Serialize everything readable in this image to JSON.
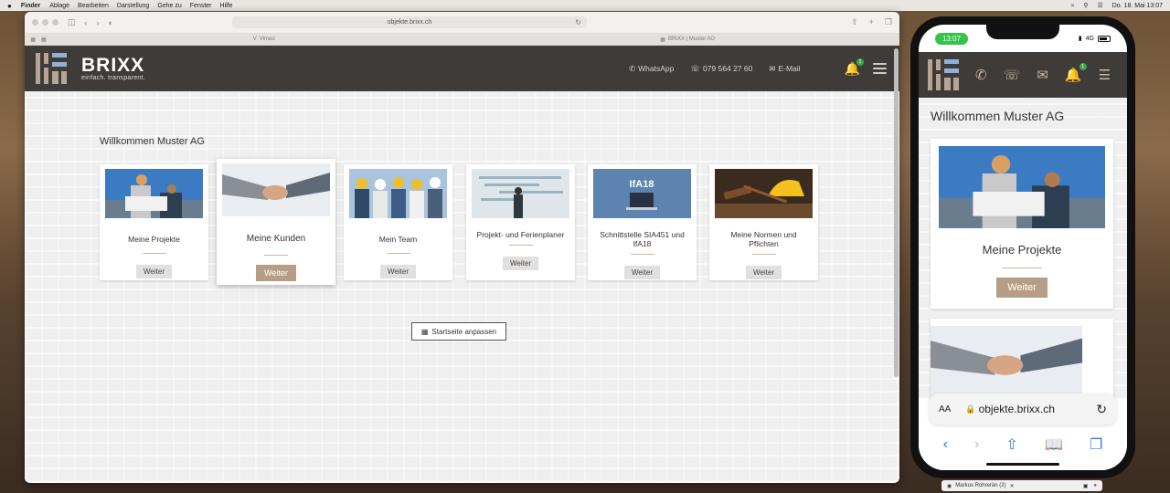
{
  "menubar": {
    "apple": "",
    "app": "Finder",
    "items": [
      "Ablage",
      "Bearbeiten",
      "Darstellung",
      "Gehe zu",
      "Fenster",
      "Hilfe"
    ],
    "datetime": "Do. 18. Mai 13:07"
  },
  "browser": {
    "url": "objekte.brixx.ch",
    "tabs": [
      "Vimeo",
      "BRIXX | Muster AG"
    ]
  },
  "site": {
    "brand": "BRIXX",
    "tagline": "einfach. transparent.",
    "whatsapp": "WhatsApp",
    "phone": "079 564 27 60",
    "email": "E-Mail",
    "notification_count": "1",
    "welcome": "Willkommen Muster AG",
    "cards": [
      {
        "title": "Meine Projekte",
        "button": "Weiter"
      },
      {
        "title": "Meine Kunden",
        "button": "Weiter"
      },
      {
        "title": "Mein Team",
        "button": "Weiter"
      },
      {
        "title": "Projekt- und Ferienplaner",
        "button": "Weiter"
      },
      {
        "title": "Schnittstelle SIA451 und IfA18",
        "button": "Weiter",
        "image_text": "IfA18"
      },
      {
        "title": "Meine Normen und Pflichten",
        "button": "Weiter"
      }
    ],
    "customize_button": "Startseite anpassen"
  },
  "phone": {
    "time": "13:07",
    "network": "4G",
    "notification_count": "1",
    "welcome": "Willkommen Muster AG",
    "card_title": "Meine Projekte",
    "card_button": "Weiter",
    "url": "objekte.brixx.ch",
    "aa": "AA"
  },
  "floatbar": {
    "label": "Markus Rohrerän (2)"
  },
  "colors": {
    "header_bg": "#3f3b39",
    "accent": "#b79d86",
    "badge": "#3aa84a"
  }
}
